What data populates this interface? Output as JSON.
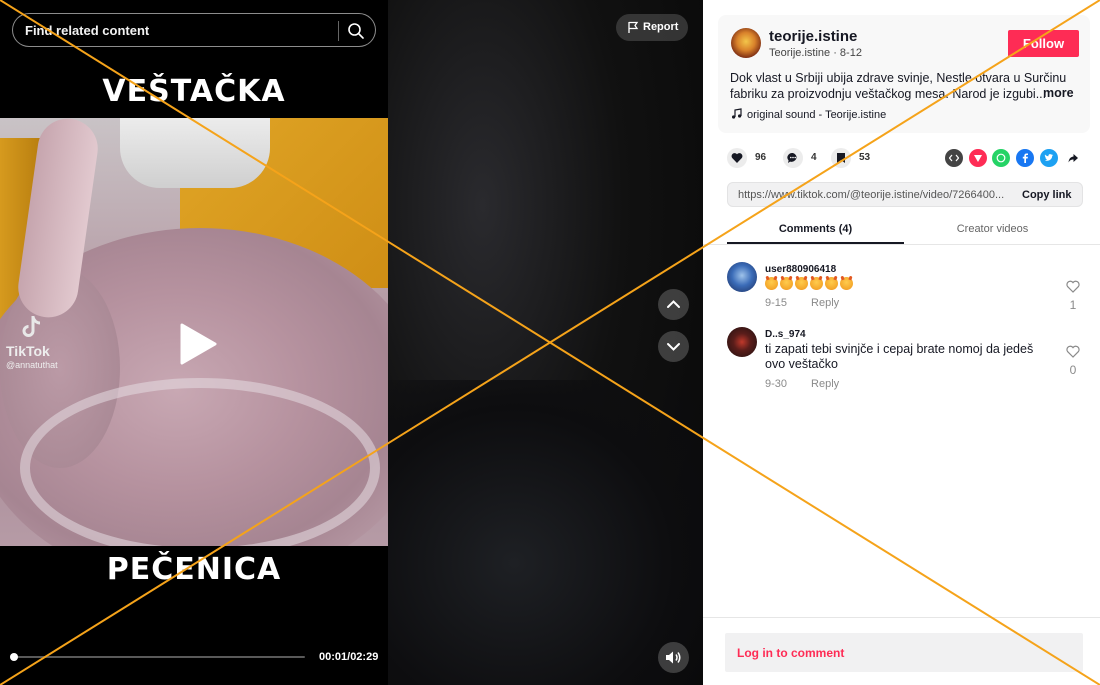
{
  "search": {
    "placeholder": "Find related content"
  },
  "video": {
    "caption_top": "VEŠTAČKA",
    "caption_bottom": "PEČENICA",
    "watermark_brand": "TikTok",
    "watermark_handle": "@annatuthat",
    "time": "00:01/02:29",
    "progress": 0.007
  },
  "report": {
    "label": "Report"
  },
  "post": {
    "author": "teorije.istine",
    "subline": "Teorije.istine · 8-12",
    "follow_label": "Follow",
    "description": "Dok vlast u Srbiji ubija zdrave svinje, Nestle otvara u Surčinu fabriku za proizvodnju veštačkog mesa. Narod je izgubi...",
    "more_label": "more",
    "sound": "original sound - Teorije.istine"
  },
  "actions": {
    "likes": "96",
    "comments": "4",
    "saves": "53"
  },
  "share_icons": [
    {
      "name": "embed-icon",
      "color": "#444444"
    },
    {
      "name": "send-icon",
      "color": "#fe2c55"
    },
    {
      "name": "whatsapp-icon",
      "color": "#25d366"
    },
    {
      "name": "facebook-icon",
      "color": "#1877f2"
    },
    {
      "name": "twitter-icon",
      "color": "#1da1f2"
    },
    {
      "name": "share-arrow-icon",
      "color": "#161823"
    }
  ],
  "link": {
    "url": "https://www.tiktok.com/@teorije.istine/video/7266400...",
    "copy_label": "Copy link"
  },
  "tabs": {
    "comments": "Comments (4)",
    "creator": "Creator videos"
  },
  "comments": [
    {
      "user": "user880906418",
      "text": "",
      "emoji_count": 6,
      "date": "9-15",
      "reply": "Reply",
      "likes": "1"
    },
    {
      "user": "D..s_974",
      "text": "ti zapati tebi svinjče i cepaj brate nomoj da jedeš ovo veštačko",
      "date": "9-30",
      "reply": "Reply",
      "likes": "0"
    }
  ],
  "login": {
    "label": "Log in to comment"
  },
  "colors": {
    "accent": "#fe2c55",
    "overlay_x": "#f5a31a"
  }
}
